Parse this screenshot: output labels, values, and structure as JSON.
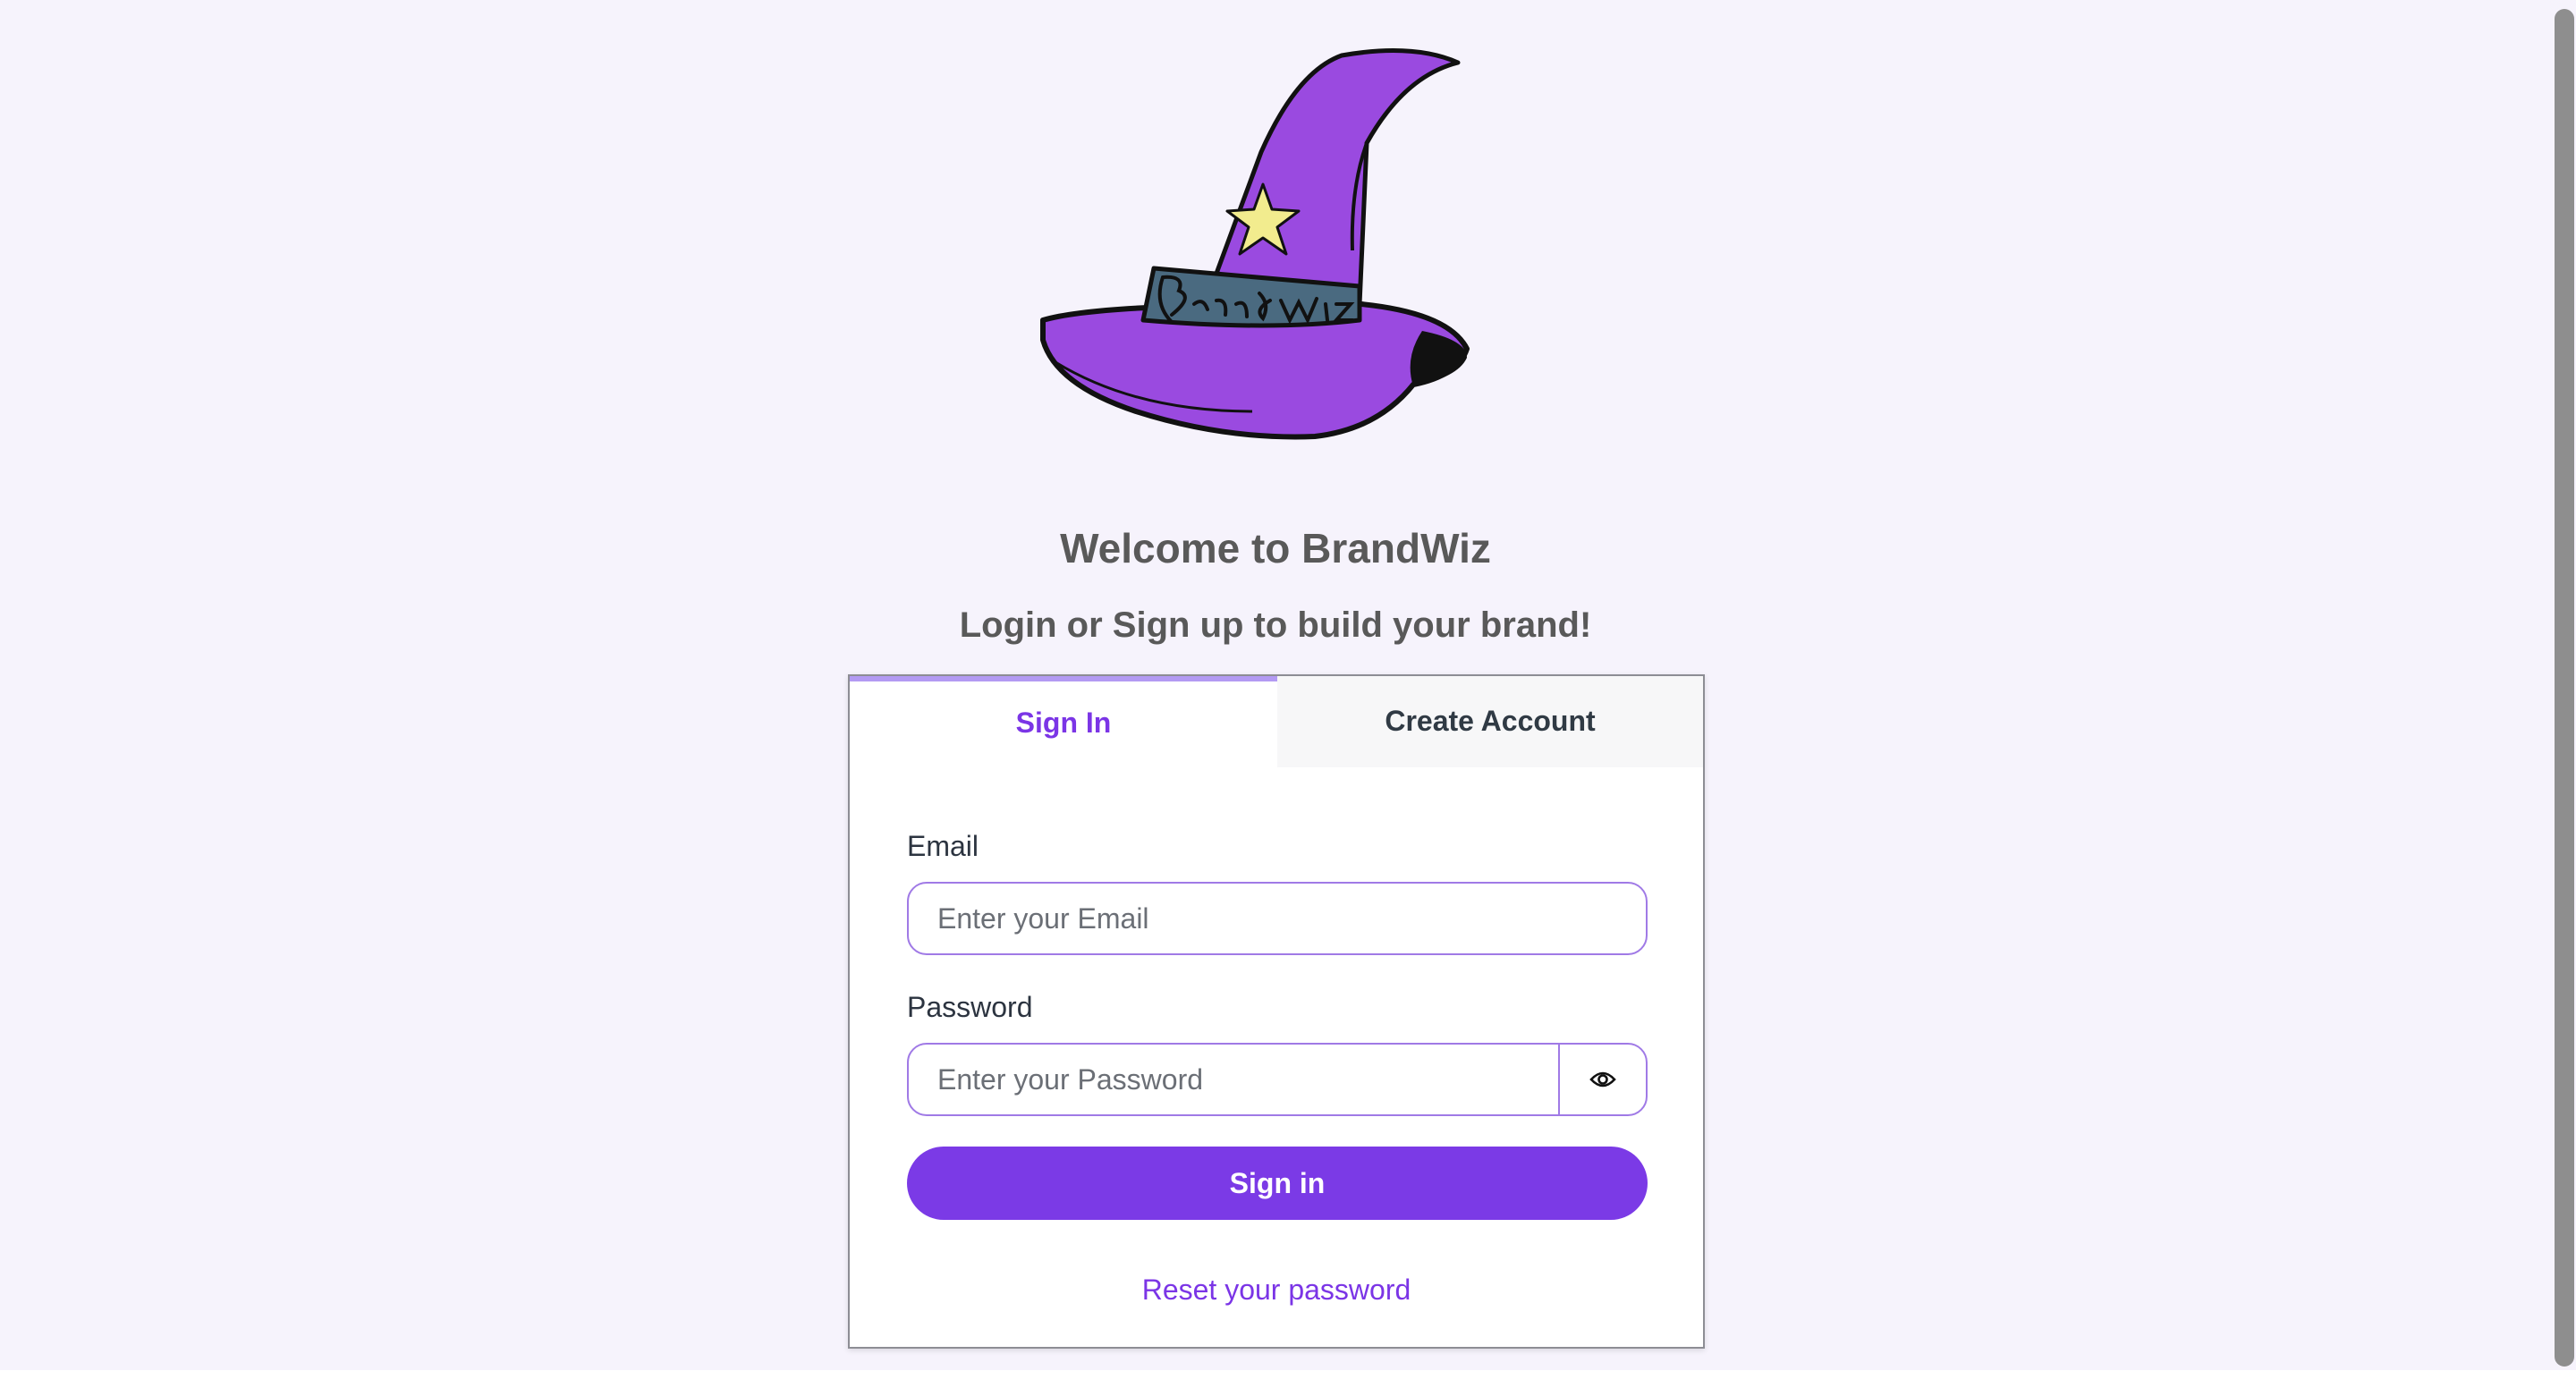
{
  "header": {
    "logo_text": "BrandWiz",
    "welcome": "Welcome to BrandWiz",
    "subtitle": "Login or Sign up to build your brand!"
  },
  "tabs": {
    "active": "Sign In",
    "items": [
      {
        "label": "Sign In",
        "active": true
      },
      {
        "label": "Create Account",
        "active": false
      }
    ]
  },
  "form": {
    "email_label": "Email",
    "email_placeholder": "Enter your Email",
    "email_value": "",
    "password_label": "Password",
    "password_placeholder": "Enter your Password",
    "password_value": "",
    "show_password_icon": "eye-icon",
    "submit_label": "Sign in",
    "reset_link": "Reset your password"
  },
  "colors": {
    "accent": "#7b3ae6",
    "background": "#f6f3fc",
    "hat_purple": "#9a4ae0",
    "hat_band": "#4a6a80",
    "star": "#f2ec8e"
  }
}
